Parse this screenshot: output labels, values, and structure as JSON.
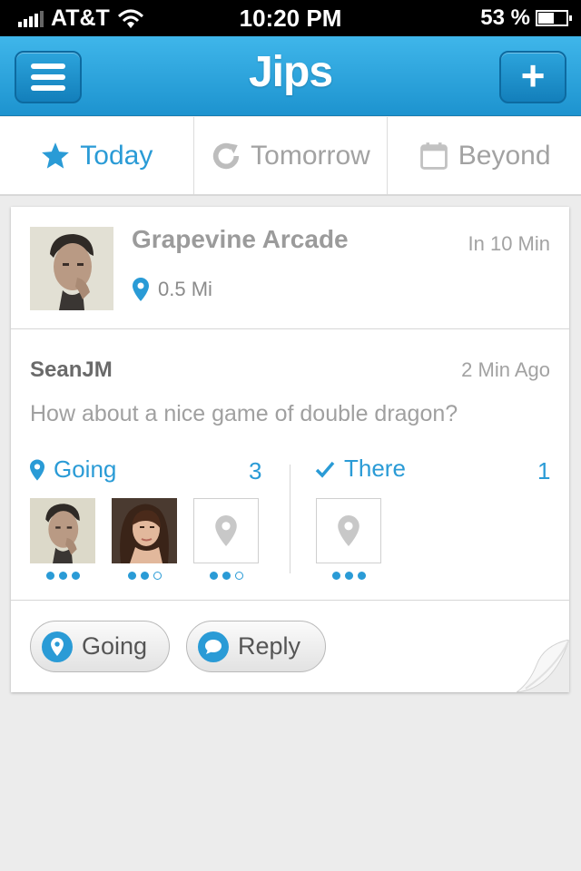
{
  "status_bar": {
    "carrier": "AT&T",
    "time": "10:20 PM",
    "battery": "53 %"
  },
  "nav": {
    "title": "Jips",
    "menu_icon": "hamburger-icon",
    "add_icon": "plus-icon",
    "add_label": "+"
  },
  "tabs": [
    {
      "label": "Today",
      "icon": "star-icon",
      "active": true
    },
    {
      "label": "Tomorrow",
      "icon": "refresh-icon",
      "active": false
    },
    {
      "label": "Beyond",
      "icon": "calendar-icon",
      "active": false
    }
  ],
  "event": {
    "venue": "Grapevine Arcade",
    "eta": "In 10 Min",
    "distance": "0.5 Mi"
  },
  "post": {
    "author": "SeanJM",
    "time_ago": "2 Min Ago",
    "message": "How about a nice game of double dragon?"
  },
  "going": {
    "label": "Going",
    "count": "3"
  },
  "there": {
    "label": "There",
    "count": "1"
  },
  "actions": {
    "going_label": "Going",
    "reply_label": "Reply"
  },
  "colors": {
    "accent": "#2a9bd6",
    "nav_top": "#3fb6ea",
    "nav_bottom": "#1d93cf"
  }
}
